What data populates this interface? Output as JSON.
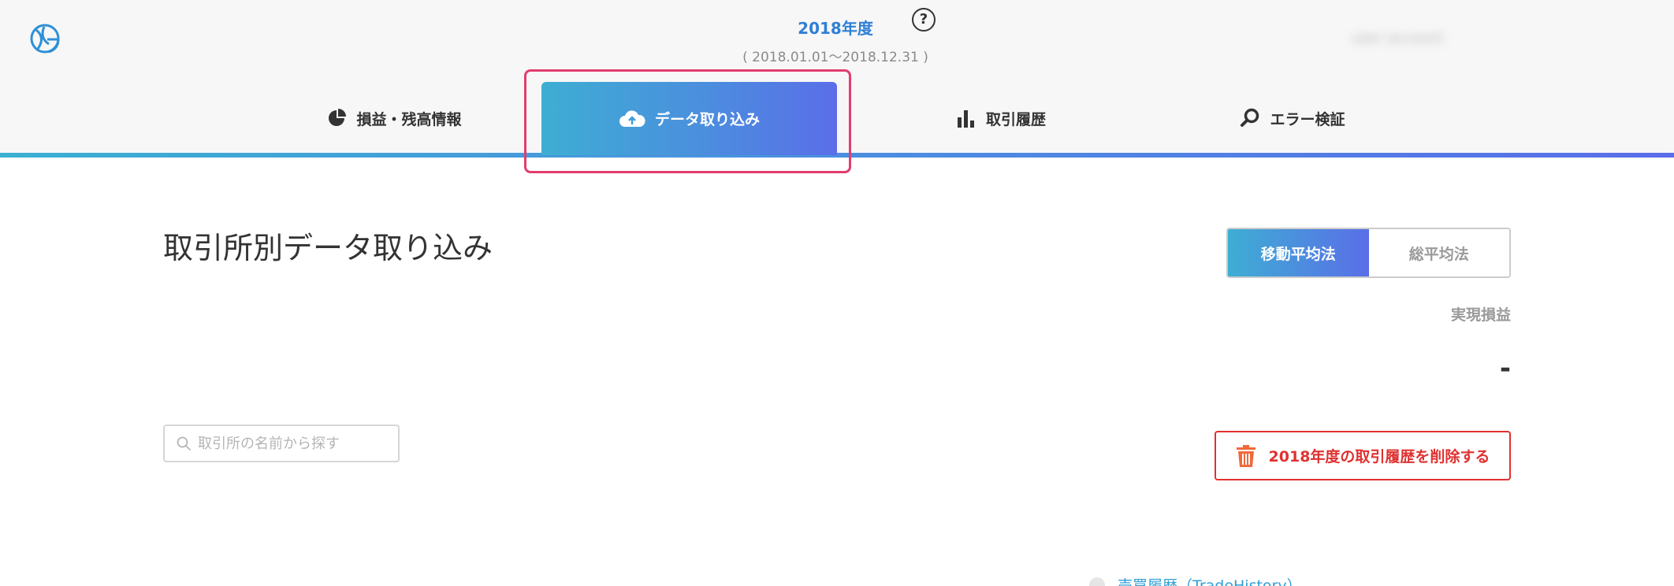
{
  "header": {
    "fiscal_year": "2018年度",
    "date_range": "( 2018.01.01～2018.12.31 )",
    "help": "?",
    "account_label": "user account"
  },
  "nav": {
    "tabs": [
      {
        "label": "損益・残高情報",
        "icon": "pie-chart-icon"
      },
      {
        "label": "データ取り込み",
        "icon": "cloud-upload-icon",
        "active": true
      },
      {
        "label": "取引履歴",
        "icon": "bar-chart-icon"
      },
      {
        "label": "エラー検証",
        "icon": "search-icon"
      }
    ]
  },
  "main": {
    "page_title": "取引所別データ取り込み",
    "method_toggle": {
      "options": [
        "移動平均法",
        "総平均法"
      ],
      "selected": "移動平均法"
    },
    "realized_pnl_label": "実現損益",
    "realized_pnl_value": "-",
    "search_placeholder": "取引所の名前から探す",
    "delete_button_label": "2018年度の取引履歴を削除する",
    "trade_history_link": "売買履歴（TradeHistory）"
  },
  "colors": {
    "accent_blue": "#2f7fd6",
    "gradient_start": "#3eaed3",
    "gradient_end": "#5a6ee8",
    "danger_red": "#e03131",
    "highlight_pink": "#e23d6f"
  }
}
